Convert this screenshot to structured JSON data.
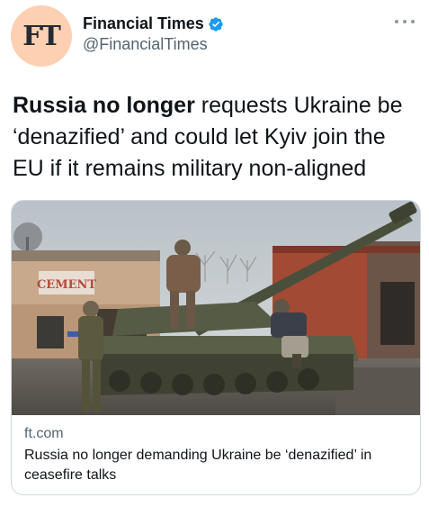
{
  "account": {
    "avatar_text": "FT",
    "display_name": "Financial Times",
    "handle": "@FinancialTimes",
    "verified": true,
    "verified_icon": "verified-badge-icon",
    "avatar_color": "#fcd0b1"
  },
  "tweet": {
    "text_bold": "Russia no longer",
    "text_rest": " requests Ukraine be ‘denazified’ and could let Kyiv join the EU if it remains military non-aligned"
  },
  "link_card": {
    "image_sign_text": "CEMENT",
    "domain": "ft.com",
    "title": "Russia no longer demanding Ukraine be ‘denazified’ in ceasefire talks"
  },
  "colors": {
    "verified_blue": "#1d9bf0",
    "secondary_text": "#536471",
    "border": "#cfd9de"
  }
}
